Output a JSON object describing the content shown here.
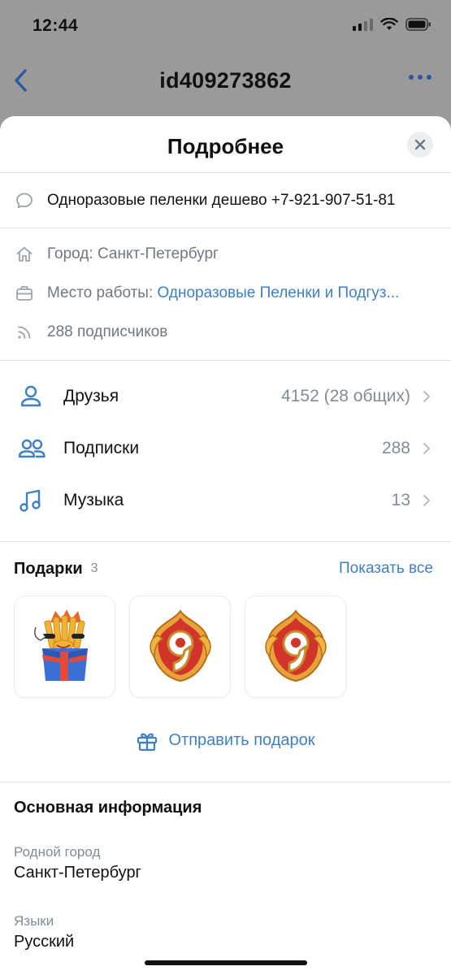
{
  "status_bar": {
    "time": "12:44"
  },
  "nav": {
    "title": "id409273862"
  },
  "sheet": {
    "title": "Подробнее",
    "status_text": "Одноразовые пеленки дешево +7-921-907-51-81",
    "city": "Город: Санкт-Петербург",
    "work_label": "Место работы:",
    "work_value": "Одноразовые Пеленки и Подгуз...",
    "followers": "288 подписчиков",
    "counters": [
      {
        "label": "Друзья",
        "value": "4152 (28 общих)"
      },
      {
        "label": "Подписки",
        "value": "288"
      },
      {
        "label": "Музыка",
        "value": "13"
      }
    ],
    "gifts": {
      "title": "Подарки",
      "count": "3",
      "show_all": "Показать все",
      "items": [
        "gift-fries-box",
        "gift-anniversary-9",
        "gift-anniversary-9"
      ]
    },
    "send_gift": "Отправить подарок",
    "basic_info": {
      "title": "Основная информация",
      "hometown_label": "Родной город",
      "hometown_value": "Санкт-Петербург",
      "languages_label": "Языки",
      "languages_value": "Русский"
    }
  },
  "colors": {
    "accent": "#3f7fc6",
    "secondary_text": "#818c99"
  }
}
